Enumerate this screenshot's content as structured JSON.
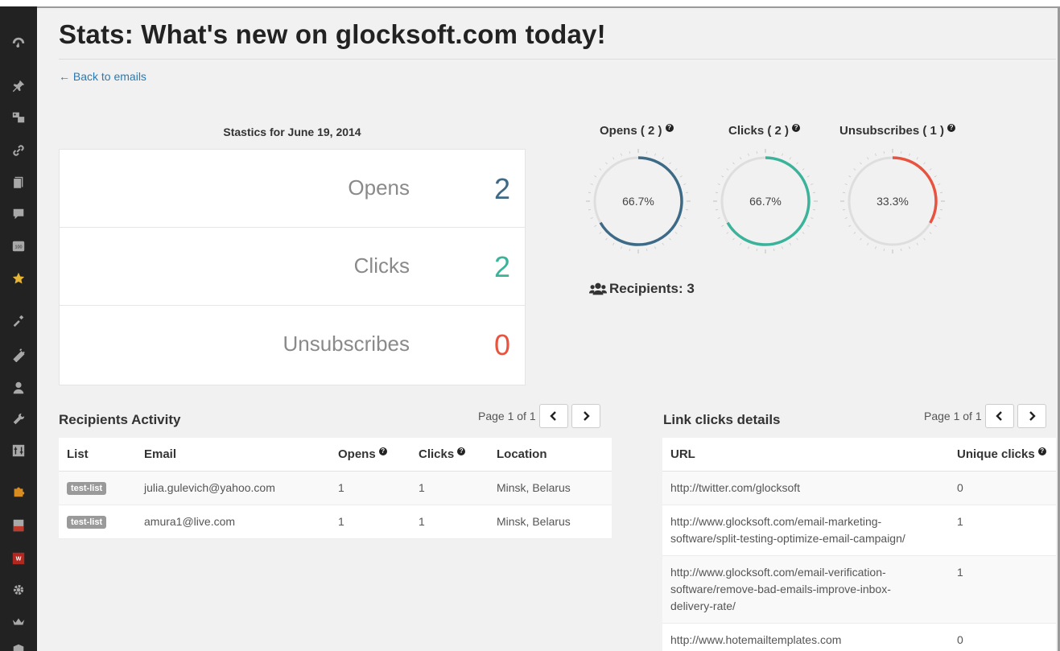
{
  "colors": {
    "opens": "#3d6a86",
    "clicks": "#3bb39a",
    "unsubscribes": "#e8533f",
    "gauge_track": "#dedede",
    "link": "#2a7ab0"
  },
  "sidebar": {
    "items": [
      {
        "icon": "dashboard-icon"
      },
      {
        "icon": "pin-icon"
      },
      {
        "icon": "media-icon"
      },
      {
        "icon": "link-icon"
      },
      {
        "icon": "pages-icon"
      },
      {
        "icon": "comments-icon"
      },
      {
        "icon": "newsletter-icon"
      },
      {
        "icon": "star-icon",
        "active": true
      },
      {
        "icon": "appearance-icon"
      },
      {
        "icon": "plugins-icon"
      },
      {
        "icon": "users-icon"
      },
      {
        "icon": "tools-icon"
      },
      {
        "icon": "settings-icon"
      },
      {
        "icon": "plugin-puzzle-icon"
      },
      {
        "icon": "forms-icon"
      },
      {
        "icon": "wp-plugin-icon"
      },
      {
        "icon": "gear-icon"
      },
      {
        "icon": "crown-icon"
      },
      {
        "icon": "shield-icon"
      }
    ]
  },
  "header": {
    "title": "Stats: What's new on glocksoft.com today!",
    "back_link": "← Back to emails"
  },
  "stats": {
    "heading": "Stastics for June 19, 2014",
    "rows": [
      {
        "label": "Opens",
        "value": "2",
        "color": "#3d6a86"
      },
      {
        "label": "Clicks",
        "value": "2",
        "color": "#3bb39a"
      },
      {
        "label": "Unsubscribes",
        "value": "0",
        "color": "#e8533f"
      }
    ]
  },
  "gauges": [
    {
      "title": "Opens ( 2 )",
      "percent_label": "66.7%",
      "fraction": 0.667,
      "color": "#3d6a86",
      "help_icon": "question-icon"
    },
    {
      "title": "Clicks ( 2 )",
      "percent_label": "66.7%",
      "fraction": 0.667,
      "color": "#3bb39a",
      "help_icon": "question-icon"
    },
    {
      "title": "Unsubscribes ( 1 )",
      "percent_label": "33.3%",
      "fraction": 0.333,
      "color": "#e8533f",
      "help_icon": "question-icon"
    }
  ],
  "recipients": {
    "icon": "users-group-icon",
    "label": "Recipients: 3"
  },
  "activity": {
    "title": "Recipients Activity",
    "pager": {
      "text": "Page 1 of 1",
      "prev_icon": "chevron-left-icon",
      "next_icon": "chevron-right-icon"
    },
    "columns": [
      "List",
      "Email",
      "Opens",
      "Clicks",
      "Location"
    ],
    "rows": [
      {
        "list": "test-list",
        "email": "julia.gulevich@yahoo.com",
        "opens": "1",
        "clicks": "1",
        "location": "Minsk, Belarus"
      },
      {
        "list": "test-list",
        "email": "amura1@live.com",
        "opens": "1",
        "clicks": "1",
        "location": "Minsk, Belarus"
      }
    ]
  },
  "links": {
    "title": "Link clicks details",
    "pager": {
      "text": "Page 1 of 1",
      "prev_icon": "chevron-left-icon",
      "next_icon": "chevron-right-icon"
    },
    "columns": [
      "URL",
      "Unique clicks"
    ],
    "rows": [
      {
        "url_lines": [
          "http://twitter.com/glocksoft"
        ],
        "clicks": "0"
      },
      {
        "url_lines": [
          "http://www.glocksoft.com/email-marketing-",
          "software/split-testing-optimize-email-campaign/"
        ],
        "clicks": "1"
      },
      {
        "url_lines": [
          "http://www.glocksoft.com/email-verification-",
          "software/remove-bad-emails-improve-inbox-",
          "delivery-rate/"
        ],
        "clicks": "1"
      },
      {
        "url_lines": [
          "http://www.hotemailtemplates.com"
        ],
        "clicks": "0"
      }
    ]
  }
}
